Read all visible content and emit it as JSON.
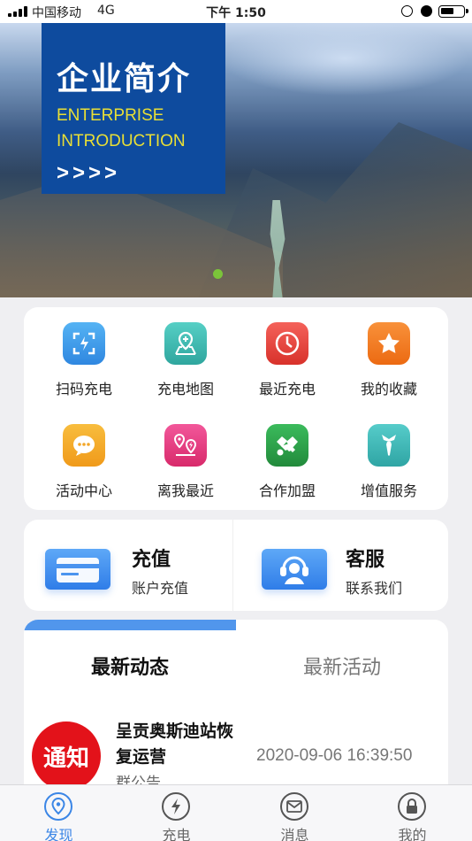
{
  "status_bar": {
    "carrier": "中国移动",
    "network": "4G",
    "time": "下午 1:50"
  },
  "banner": {
    "title": "企业简介",
    "subtitle_line1": "ENTERPRISE",
    "subtitle_line2": "INTRODUCTION",
    "arrows": ">>>>",
    "active_dot_color": "#7bc43a"
  },
  "menu": {
    "items": [
      {
        "label": "扫码充电",
        "icon": "scan-icon",
        "color": "#3d9be6"
      },
      {
        "label": "充电地图",
        "icon": "map-icon",
        "color": "#3fb8b0"
      },
      {
        "label": "最近充电",
        "icon": "clock-icon",
        "color": "#e8453c"
      },
      {
        "label": "我的收藏",
        "icon": "star-icon",
        "color": "#f07a1e"
      },
      {
        "label": "活动中心",
        "icon": "chat-icon",
        "color": "#f3a72a"
      },
      {
        "label": "离我最近",
        "icon": "nearby-icon",
        "color": "#e2377c"
      },
      {
        "label": "合作加盟",
        "icon": "handshake-icon",
        "color": "#2fa24a"
      },
      {
        "label": "增值服务",
        "icon": "tie-icon",
        "color": "#3fb7b6"
      }
    ]
  },
  "actions": {
    "recharge": {
      "title": "充值",
      "subtitle": "账户充值",
      "icon": "card-icon"
    },
    "service": {
      "title": "客服",
      "subtitle": "联系我们",
      "icon": "headset-icon"
    }
  },
  "news": {
    "tabs": {
      "latest_news": "最新动态",
      "latest_activities": "最新活动"
    },
    "items": [
      {
        "thumb_text": "通知",
        "title": "呈贡奥斯迪站恢复运营",
        "source": "群公告",
        "time": "2020-09-06 16:39:50"
      }
    ]
  },
  "tabbar": {
    "items": [
      {
        "label": "发现",
        "icon": "discover-icon",
        "active": true
      },
      {
        "label": "充电",
        "icon": "charge-icon",
        "active": false
      },
      {
        "label": "消息",
        "icon": "message-icon",
        "active": false
      },
      {
        "label": "我的",
        "icon": "profile-icon",
        "active": false
      }
    ],
    "active_color": "#3b86e6"
  }
}
